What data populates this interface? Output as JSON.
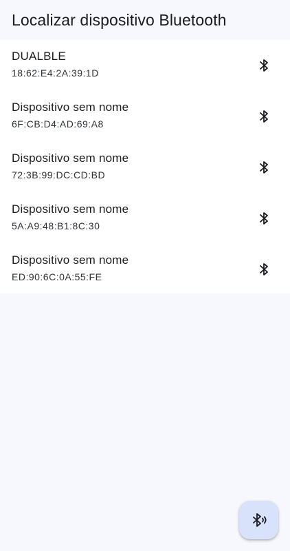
{
  "app_bar": {
    "title": "Localizar dispositivo Bluetooth"
  },
  "devices": [
    {
      "name": "DUALBLE",
      "address": "18:62:E4:2A:39:1D",
      "icon": "bluetooth-icon"
    },
    {
      "name": "Dispositivo sem nome",
      "address": "6F:CB:D4:AD:69:A8",
      "icon": "bluetooth-icon"
    },
    {
      "name": "Dispositivo sem nome",
      "address": "72:3B:99:DC:CD:BD",
      "icon": "bluetooth-icon"
    },
    {
      "name": "Dispositivo sem nome",
      "address": "5A:A9:48:B1:8C:30",
      "icon": "bluetooth-icon"
    },
    {
      "name": "Dispositivo sem nome",
      "address": "ED:90:6C:0A:55:FE",
      "icon": "bluetooth-icon"
    }
  ],
  "fab": {
    "icon": "bluetooth-searching-icon"
  },
  "colors": {
    "background": "#f7f8fd",
    "list_background": "#ffffff",
    "fab_background": "#d8e3fb",
    "text_primary": "#1b1c21"
  }
}
